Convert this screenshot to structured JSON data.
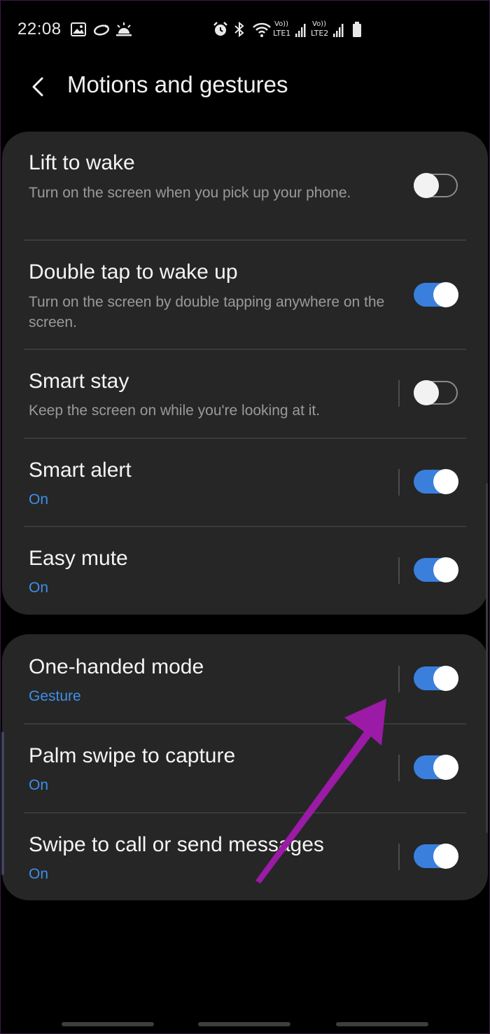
{
  "status_bar": {
    "time": "22:08",
    "left_icons": [
      "gallery-icon",
      "sync-icon",
      "weather-icon"
    ],
    "right_icons": [
      "alarm-icon",
      "bluetooth-icon",
      "wifi-icon",
      "lte1-signal-icon",
      "lte2-signal-icon",
      "battery-icon"
    ],
    "lte1_label": "LTE1",
    "lte2_label": "LTE2",
    "volte1_label": "Vo))",
    "volte2_label": "Vo))"
  },
  "header": {
    "back_icon": "chevron-left-icon",
    "title": "Motions and gestures"
  },
  "sections": [
    {
      "items": [
        {
          "title": "Lift to wake",
          "subtitle": "Turn on the screen when you pick up your phone.",
          "enabled": false
        },
        {
          "title": "Double tap to wake up",
          "subtitle": "Turn on the screen by double tapping anywhere on the screen.",
          "enabled": true
        },
        {
          "title": "Smart stay",
          "subtitle": "Keep the screen on while you're looking at it.",
          "enabled": false
        },
        {
          "title": "Smart alert",
          "subtitle": "On",
          "enabled": true
        },
        {
          "title": "Easy mute",
          "subtitle": "On",
          "enabled": true
        }
      ]
    },
    {
      "items": [
        {
          "title": "One-handed mode",
          "subtitle": "Gesture",
          "enabled": true
        },
        {
          "title": "Palm swipe to capture",
          "subtitle": "On",
          "enabled": true
        },
        {
          "title": "Swipe to call or send messages",
          "subtitle": "On",
          "enabled": true
        }
      ]
    }
  ],
  "colors": {
    "background": "#000000",
    "card": "#262626",
    "accent": "#3e8fe8",
    "toggle_on": "#3a7fdc",
    "annotation_arrow": "#9b1aa6"
  }
}
